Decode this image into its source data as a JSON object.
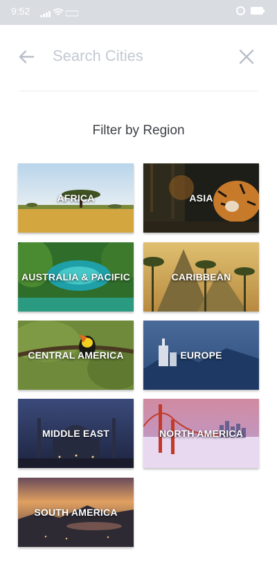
{
  "status_bar": {
    "time": "9:52",
    "icons": [
      "signal-icon",
      "wifi-icon",
      "data-speed-icon",
      "alarm-icon",
      "battery-icon"
    ]
  },
  "search": {
    "placeholder": "Search Cities",
    "value": ""
  },
  "filter": {
    "title": "Filter by Region",
    "regions": [
      {
        "label": "AFRICA"
      },
      {
        "label": "ASIA"
      },
      {
        "label": "AUSTRALIA & PACIFIC"
      },
      {
        "label": "CARIBBEAN"
      },
      {
        "label": "CENTRAL AMERICA"
      },
      {
        "label": "EUROPE"
      },
      {
        "label": "MIDDLE EAST"
      },
      {
        "label": "NORTH AMERICA"
      },
      {
        "label": "SOUTH AMERICA"
      }
    ]
  }
}
